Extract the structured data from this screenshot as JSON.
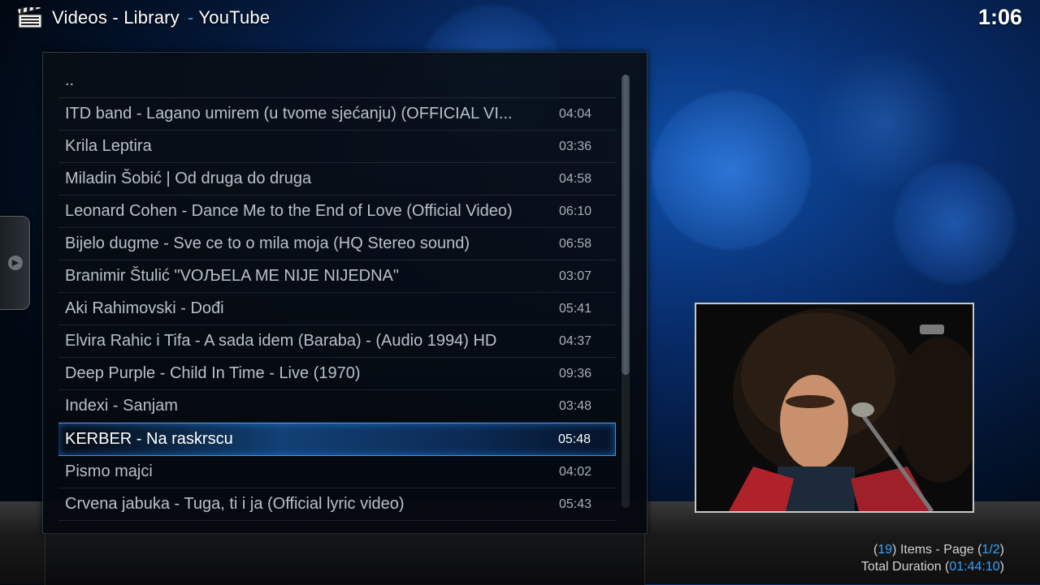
{
  "header": {
    "section": "Videos - Library",
    "separator": "-",
    "source": "YouTube",
    "clock": "1:06"
  },
  "list": {
    "parent_label": "..",
    "items": [
      {
        "title": "ITD band - Lagano umirem (u tvome sjećanju) (OFFICIAL VI...",
        "duration": "04:04"
      },
      {
        "title": "Krila Leptira",
        "duration": "03:36"
      },
      {
        "title": "Miladin Šobić | Od druga do druga",
        "duration": "04:58"
      },
      {
        "title": "Leonard Cohen - Dance Me to the End of Love (Official Video)",
        "duration": "06:10"
      },
      {
        "title": "Bijelo dugme - Sve ce to o mila moja  (HQ Stereo sound)",
        "duration": "06:58"
      },
      {
        "title": "Branimir Štulić \"VOЉELA ME NIJE NIJEDNA\"",
        "duration": "03:07"
      },
      {
        "title": "Aki Rahimovski - Dođi",
        "duration": "05:41"
      },
      {
        "title": "Elvira Rahic i Tifa - A sada idem (Baraba) - (Audio 1994) HD",
        "duration": "04:37"
      },
      {
        "title": "Deep Purple - Child In Time - Live (1970)",
        "duration": "09:36"
      },
      {
        "title": "Indexi - Sanjam",
        "duration": "03:48"
      },
      {
        "title": "KERBER - Na raskrscu",
        "duration": "05:48",
        "selected": true
      },
      {
        "title": "Pismo majci",
        "duration": "04:02"
      },
      {
        "title": "Crvena jabuka - Tuga, ti i ja (Official lyric video)",
        "duration": "05:43"
      }
    ]
  },
  "footer": {
    "item_count": "19",
    "items_label": "Items - Page",
    "page": "1/2",
    "total_label": "Total Duration",
    "total_duration": "01:44:10"
  },
  "colors": {
    "accent": "#3aa0ff",
    "selection": "#1e6ec8"
  },
  "icons": {
    "header": "clapperboard-icon",
    "sidetab": "chevron-right-icon"
  }
}
